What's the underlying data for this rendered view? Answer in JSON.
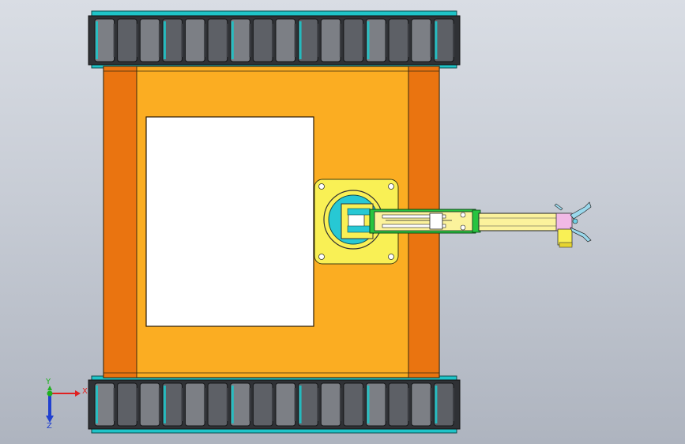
{
  "viewport": {
    "background_top": "#d9dde4",
    "background_bottom": "#aeb4bf"
  },
  "colors": {
    "body_orange": "#fbad22",
    "side_orange": "#ea7410",
    "outline": "#3a2a10",
    "track_dark": "#3b3d42",
    "track_mid": "#5d6066",
    "track_light": "#7c7f85",
    "track_accent": "#1fc4c8",
    "arm_yellow": "#fbf29c",
    "turntable_yellow": "#f9f055",
    "turntable_cyan": "#27c8d4",
    "arm_green": "#27c440",
    "gripper_pink": "#f1b9e6",
    "panel_white": "#ffffff"
  },
  "triad": {
    "x_label": "X",
    "y_label": "Y",
    "z_label": "Z",
    "x_color": "#e02020",
    "y_color": "#20b020",
    "z_color": "#2040d0"
  },
  "robot": {
    "track_top_treads": 16,
    "track_bottom_treads": 16
  }
}
